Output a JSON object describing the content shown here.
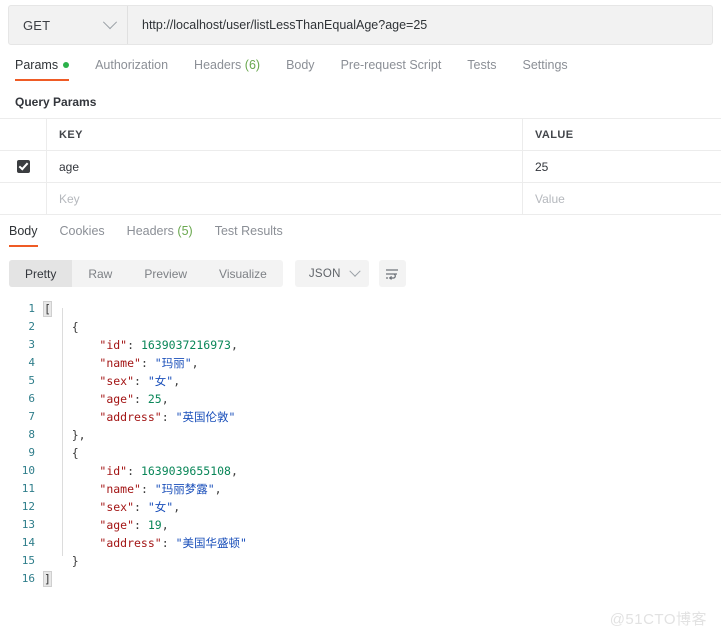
{
  "request": {
    "method": "GET",
    "url": "http://localhost/user/listLessThanEqualAge?age=25",
    "tabs": [
      {
        "label": "Params",
        "active": true,
        "dot": true
      },
      {
        "label": "Authorization",
        "active": false
      },
      {
        "label": "Headers",
        "count": "(6)",
        "active": false
      },
      {
        "label": "Body",
        "active": false
      },
      {
        "label": "Pre-request Script",
        "active": false
      },
      {
        "label": "Tests",
        "active": false
      },
      {
        "label": "Settings",
        "active": false
      }
    ],
    "query_params_title": "Query Params",
    "table": {
      "headers": {
        "key": "KEY",
        "value": "VALUE"
      },
      "rows": [
        {
          "checked": true,
          "key": "age",
          "value": "25"
        }
      ],
      "placeholder_row": {
        "key": "Key",
        "value": "Value"
      }
    }
  },
  "response": {
    "tabs": [
      {
        "label": "Body",
        "active": true
      },
      {
        "label": "Cookies",
        "active": false
      },
      {
        "label": "Headers",
        "count": "(5)",
        "active": false
      },
      {
        "label": "Test Results",
        "active": false
      }
    ],
    "view_modes": [
      {
        "label": "Pretty",
        "active": true
      },
      {
        "label": "Raw",
        "active": false
      },
      {
        "label": "Preview",
        "active": false
      },
      {
        "label": "Visualize",
        "active": false
      }
    ],
    "format": "JSON",
    "wrap_icon": "wrap-text-icon",
    "body_lines": [
      {
        "n": "1",
        "tokens": [
          {
            "t": "[",
            "c": "punc",
            "hl": true
          }
        ]
      },
      {
        "n": "2",
        "tokens": [
          {
            "t": "    {",
            "c": "punc"
          }
        ]
      },
      {
        "n": "3",
        "tokens": [
          {
            "t": "        ",
            "c": "punc"
          },
          {
            "t": "\"id\"",
            "c": "key"
          },
          {
            "t": ": ",
            "c": "punc"
          },
          {
            "t": "1639037216973",
            "c": "num"
          },
          {
            "t": ",",
            "c": "punc"
          }
        ]
      },
      {
        "n": "4",
        "tokens": [
          {
            "t": "        ",
            "c": "punc"
          },
          {
            "t": "\"name\"",
            "c": "key"
          },
          {
            "t": ": ",
            "c": "punc"
          },
          {
            "t": "\"玛丽\"",
            "c": "str"
          },
          {
            "t": ",",
            "c": "punc"
          }
        ]
      },
      {
        "n": "5",
        "tokens": [
          {
            "t": "        ",
            "c": "punc"
          },
          {
            "t": "\"sex\"",
            "c": "key"
          },
          {
            "t": ": ",
            "c": "punc"
          },
          {
            "t": "\"女\"",
            "c": "str"
          },
          {
            "t": ",",
            "c": "punc"
          }
        ]
      },
      {
        "n": "6",
        "tokens": [
          {
            "t": "        ",
            "c": "punc"
          },
          {
            "t": "\"age\"",
            "c": "key"
          },
          {
            "t": ": ",
            "c": "punc"
          },
          {
            "t": "25",
            "c": "num"
          },
          {
            "t": ",",
            "c": "punc"
          }
        ]
      },
      {
        "n": "7",
        "tokens": [
          {
            "t": "        ",
            "c": "punc"
          },
          {
            "t": "\"address\"",
            "c": "key"
          },
          {
            "t": ": ",
            "c": "punc"
          },
          {
            "t": "\"英国伦敦\"",
            "c": "str"
          }
        ]
      },
      {
        "n": "8",
        "tokens": [
          {
            "t": "    },",
            "c": "punc"
          }
        ]
      },
      {
        "n": "9",
        "tokens": [
          {
            "t": "    {",
            "c": "punc"
          }
        ]
      },
      {
        "n": "10",
        "tokens": [
          {
            "t": "        ",
            "c": "punc"
          },
          {
            "t": "\"id\"",
            "c": "key"
          },
          {
            "t": ": ",
            "c": "punc"
          },
          {
            "t": "1639039655108",
            "c": "num"
          },
          {
            "t": ",",
            "c": "punc"
          }
        ]
      },
      {
        "n": "11",
        "tokens": [
          {
            "t": "        ",
            "c": "punc"
          },
          {
            "t": "\"name\"",
            "c": "key"
          },
          {
            "t": ": ",
            "c": "punc"
          },
          {
            "t": "\"玛丽梦露\"",
            "c": "str"
          },
          {
            "t": ",",
            "c": "punc"
          }
        ]
      },
      {
        "n": "12",
        "tokens": [
          {
            "t": "        ",
            "c": "punc"
          },
          {
            "t": "\"sex\"",
            "c": "key"
          },
          {
            "t": ": ",
            "c": "punc"
          },
          {
            "t": "\"女\"",
            "c": "str"
          },
          {
            "t": ",",
            "c": "punc"
          }
        ]
      },
      {
        "n": "13",
        "tokens": [
          {
            "t": "        ",
            "c": "punc"
          },
          {
            "t": "\"age\"",
            "c": "key"
          },
          {
            "t": ": ",
            "c": "punc"
          },
          {
            "t": "19",
            "c": "num"
          },
          {
            "t": ",",
            "c": "punc"
          }
        ]
      },
      {
        "n": "14",
        "tokens": [
          {
            "t": "        ",
            "c": "punc"
          },
          {
            "t": "\"address\"",
            "c": "key"
          },
          {
            "t": ": ",
            "c": "punc"
          },
          {
            "t": "\"美国华盛顿\"",
            "c": "str"
          }
        ]
      },
      {
        "n": "15",
        "tokens": [
          {
            "t": "    }",
            "c": "punc"
          }
        ]
      },
      {
        "n": "16",
        "tokens": [
          {
            "t": "]",
            "c": "punc",
            "hl": true
          }
        ]
      }
    ]
  },
  "watermark": "@51CTO博客",
  "colors": {
    "accent_orange": "#ef5b25",
    "status_green": "#2bb14a",
    "json_key": "#a31515",
    "json_string": "#1a4fba",
    "json_number": "#098658",
    "lineno": "#2e7d8a"
  }
}
